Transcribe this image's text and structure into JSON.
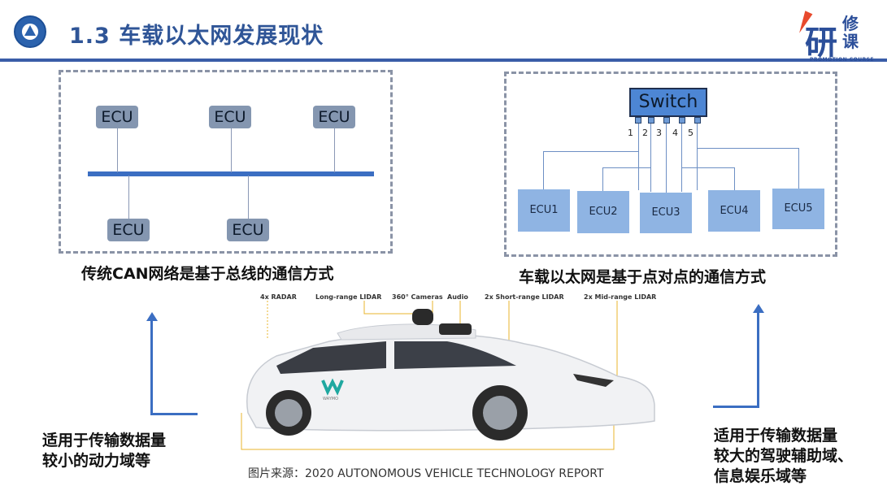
{
  "header": {
    "title": "1.3 车载以太网发展现状",
    "brand_main": "研",
    "brand_side": "修课",
    "brand_subtitle": "PROMOTION COURSE"
  },
  "can_diagram": {
    "ecus_top": [
      "ECU",
      "ECU",
      "ECU"
    ],
    "ecus_bottom": [
      "ECU",
      "ECU"
    ],
    "caption": "传统CAN网络是基于总线的通信方式"
  },
  "ethernet_diagram": {
    "switch_label": "Switch",
    "ports": [
      "1",
      "2",
      "3",
      "4",
      "5"
    ],
    "ecus": [
      "ECU1",
      "ECU2",
      "ECU3",
      "ECU4",
      "ECU5"
    ],
    "caption": "车载以太网是基于点对点的通信方式"
  },
  "car_image": {
    "sensor_labels": [
      "4x RADAR",
      "Long-range LIDAR",
      "360° Cameras",
      "Audio",
      "2x Short-range LIDAR",
      "2x Mid-range LIDAR"
    ],
    "brand_text": "WAYMO",
    "source": "图片来源：2020 AUTONOMOUS VEHICLE TECHNOLOGY REPORT"
  },
  "notes": {
    "left": [
      "适用于传输数据量",
      "较小的动力域等"
    ],
    "right": [
      "适用于传输数据量",
      "较大的驾驶辅助域、",
      "信息娱乐域等"
    ]
  },
  "colors": {
    "title": "#2f5597",
    "accent": "#3b6ec2",
    "ecu_can": "#8496b0",
    "ecu_eth": "#8fb4e3",
    "switch": "#4d86d4"
  }
}
